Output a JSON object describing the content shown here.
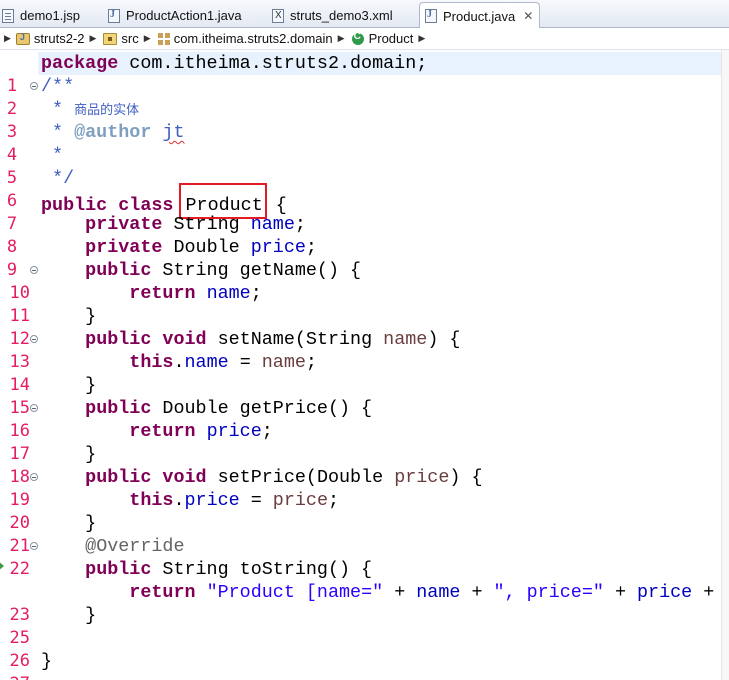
{
  "tabs": [
    {
      "label": "demo1.jsp",
      "icon": "jsp-file-icon",
      "active": false
    },
    {
      "label": "ProductAction1.java",
      "icon": "java-file-icon",
      "active": false
    },
    {
      "label": "struts_demo3.xml",
      "icon": "xml-file-icon",
      "active": false
    },
    {
      "label": "Product.java",
      "icon": "java-file-icon",
      "active": true,
      "close": "✕"
    }
  ],
  "breadcrumb": [
    {
      "label": "struts2-2",
      "icon": "java-project-icon"
    },
    {
      "label": "src",
      "icon": "source-folder-icon"
    },
    {
      "label": "com.itheima.struts2.domain",
      "icon": "package-icon"
    },
    {
      "label": "Product",
      "icon": "class-icon"
    }
  ],
  "editor": {
    "file": "Product.java",
    "highlighted_token": "Product",
    "highlight_color": "#e31b23",
    "lines": [
      {
        "n": "1",
        "text": "package com.itheima.struts2.domain;"
      },
      {
        "n": "2",
        "text": "/**"
      },
      {
        "n": "3",
        "text": " * 商品的实体"
      },
      {
        "n": "4",
        "text": " * @author jt"
      },
      {
        "n": "5",
        "text": " *"
      },
      {
        "n": "6",
        "text": " */"
      },
      {
        "n": "7",
        "text": "public class Product {"
      },
      {
        "n": "8",
        "text": "    private String name;"
      },
      {
        "n": "9",
        "text": "    private Double price;"
      },
      {
        "n": "10",
        "text": "    public String getName() {"
      },
      {
        "n": "11",
        "text": "        return name;"
      },
      {
        "n": "12",
        "text": "    }"
      },
      {
        "n": "13",
        "text": "    public void setName(String name) {"
      },
      {
        "n": "14",
        "text": "        this.name = name;"
      },
      {
        "n": "15",
        "text": "    }"
      },
      {
        "n": "16",
        "text": "    public Double getPrice() {"
      },
      {
        "n": "17",
        "text": "        return price;"
      },
      {
        "n": "18",
        "text": "    }"
      },
      {
        "n": "19",
        "text": "    public void setPrice(Double price) {"
      },
      {
        "n": "20",
        "text": "        this.price = price;"
      },
      {
        "n": "21",
        "text": "    }"
      },
      {
        "n": "22",
        "text": "    @Override"
      },
      {
        "n": "23",
        "text": "    public String toString() {"
      },
      {
        "n": "24",
        "text": "        return \"Product [name=\" + name + \", price=\" + price + "
      },
      {
        "n": "25",
        "text": "    }"
      },
      {
        "n": "26",
        "text": ""
      },
      {
        "n": "27",
        "text": "}"
      }
    ],
    "tokens": {
      "l1": [
        "package",
        " com.itheima.struts2.domain;"
      ],
      "l2": [
        "/**"
      ],
      "l3": [
        " * ",
        "商品的实体"
      ],
      "l4": [
        " * ",
        "@author",
        " ",
        "jt"
      ],
      "l5": [
        " *"
      ],
      "l6": [
        " */"
      ],
      "l7": [
        "public",
        " ",
        "class",
        " ",
        "Product",
        " {"
      ],
      "l8": [
        "    ",
        "private",
        " String ",
        "name",
        ";"
      ],
      "l9": [
        "    ",
        "private",
        " Double ",
        "price",
        ";"
      ],
      "l10": [
        "    ",
        "public",
        " String getName() {"
      ],
      "l11": [
        "        ",
        "return",
        " ",
        "name",
        ";"
      ],
      "l12": [
        "    }"
      ],
      "l13": [
        "    ",
        "public",
        " ",
        "void",
        " setName(String ",
        "name",
        ") {"
      ],
      "l14": [
        "        ",
        "this",
        ".",
        "name",
        " = ",
        "name",
        ";"
      ],
      "l15": [
        "    }"
      ],
      "l16": [
        "    ",
        "public",
        " Double getPrice() {"
      ],
      "l17": [
        "        ",
        "return",
        " ",
        "price",
        ";"
      ],
      "l18": [
        "    }"
      ],
      "l19": [
        "    ",
        "public",
        " ",
        "void",
        " setPrice(Double ",
        "price",
        ") {"
      ],
      "l20": [
        "        ",
        "this",
        ".",
        "price",
        " = ",
        "price",
        ";"
      ],
      "l21": [
        "    }"
      ],
      "l22": [
        "    ",
        "@Override"
      ],
      "l23": [
        "    ",
        "public",
        " String toString() {"
      ],
      "l24": [
        "        ",
        "return",
        " ",
        "\"Product [name=\"",
        " + ",
        "name",
        " + ",
        "\", price=\"",
        " + ",
        "price",
        " + "
      ],
      "l25": [
        "    }"
      ],
      "l26": [
        ""
      ],
      "l27": [
        "}"
      ]
    }
  }
}
